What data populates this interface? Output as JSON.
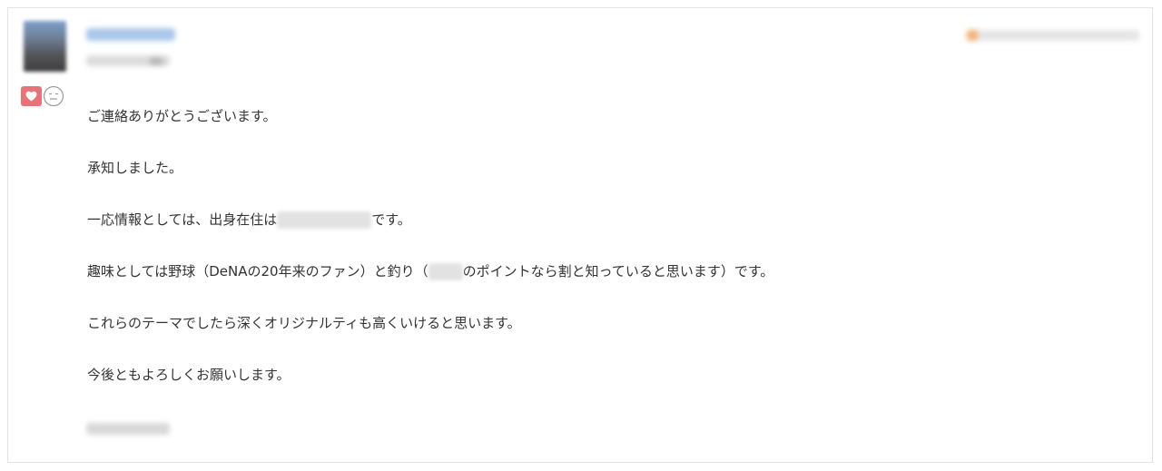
{
  "colors": {
    "link": "#a9c7ea",
    "heart": "#e87377",
    "text": "#333333",
    "border": "#e3e3e3"
  },
  "icons": {
    "heart": "heart-icon",
    "neutral": "neutral-face-icon"
  },
  "message": {
    "greeting": "ご連絡ありがとうございます。",
    "ack": "承知しました。",
    "info_before": "一応情報としては、出身在住は",
    "info_after": "です。",
    "hobby_before": "趣味としては野球（DeNAの20年来のファン）と釣り（",
    "hobby_after": "のポイントなら割と知っていると思います）です。",
    "theme": "これらのテーマでしたら深くオリジナルティも高くいけると思います。",
    "closing": "今後ともよろしくお願いします。"
  }
}
